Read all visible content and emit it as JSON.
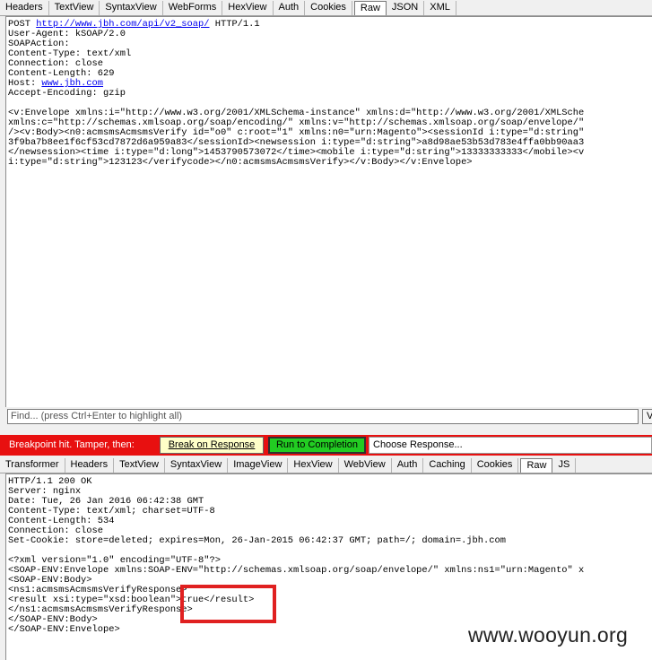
{
  "request_tabs": [
    "Headers",
    "TextView",
    "SyntaxView",
    "WebForms",
    "HexView",
    "Auth",
    "Cookies",
    "Raw",
    "JSON",
    "XML"
  ],
  "request_active_tab": "Raw",
  "request_lines": [
    {
      "pre": "POST ",
      "link": "http://www.jbh.com/api/v2_soap/",
      "post": " HTTP/1.1"
    },
    {
      "pre": "User-Agent: kSOAP/2.0"
    },
    {
      "pre": "SOAPAction:"
    },
    {
      "pre": "Content-Type: text/xml"
    },
    {
      "pre": "Connection: close"
    },
    {
      "pre": "Content-Length: 629"
    },
    {
      "pre": "Host: ",
      "link": "www.jbh.com"
    },
    {
      "pre": "Accept-Encoding: gzip"
    },
    {
      "pre": ""
    },
    {
      "pre": "<v:Envelope xmlns:i=\"http://www.w3.org/2001/XMLSchema-instance\" xmlns:d=\"http://www.w3.org/2001/XMLSche"
    },
    {
      "pre": "xmlns:c=\"http://schemas.xmlsoap.org/soap/encoding/\" xmlns:v=\"http://schemas.xmlsoap.org/soap/envelope/\""
    },
    {
      "pre": "/><v:Body><n0:acmsmsAcmsmsVerify id=\"o0\" c:root=\"1\" xmlns:n0=\"urn:Magento\"><sessionId i:type=\"d:string\""
    },
    {
      "pre": "3f9ba7b8ee1f6cf53cd7872d6a959a83</sessionId><newsession i:type=\"d:string\">a8d98ae53b53d783e4ffa0bb90aa3"
    },
    {
      "pre": "</newsession><time i:type=\"d:long\">1453790573072</time><mobile i:type=\"d:string\">13333333333</mobile><v"
    },
    {
      "pre": "i:type=\"d:string\">123123</verifycode></n0:acmsmsAcmsmsVerify></v:Body></v:Envelope>"
    }
  ],
  "find": {
    "placeholder": "Find... (press Ctrl+Enter to highlight all)",
    "button": "V"
  },
  "breakpoint": {
    "label": "Breakpoint hit. Tamper, then:",
    "break_on_response": "Break on Response",
    "run_to_completion": "Run to Completion",
    "choose_response": "Choose Response..."
  },
  "response_tabs": [
    "Transformer",
    "Headers",
    "TextView",
    "SyntaxView",
    "ImageView",
    "HexView",
    "WebView",
    "Auth",
    "Caching",
    "Cookies",
    "Raw",
    "JS"
  ],
  "response_active_tab": "Raw",
  "response_lines": [
    "HTTP/1.1 200 OK",
    "Server: nginx",
    "Date: Tue, 26 Jan 2016 06:42:38 GMT",
    "Content-Type: text/xml; charset=UTF-8",
    "Content-Length: 534",
    "Connection: close",
    "Set-Cookie: store=deleted; expires=Mon, 26-Jan-2015 06:42:37 GMT; path=/; domain=.jbh.com",
    "",
    "<?xml version=\"1.0\" encoding=\"UTF-8\"?>",
    "<SOAP-ENV:Envelope xmlns:SOAP-ENV=\"http://schemas.xmlsoap.org/soap/envelope/\" xmlns:ns1=\"urn:Magento\" x",
    "<SOAP-ENV:Body>",
    "<ns1:acmsmsAcmsmsVerifyResponse>",
    "<result xsi:type=\"xsd:boolean\">true</result>",
    "</ns1:acmsmsAcmsmsVerifyResponse>",
    "</SOAP-ENV:Body>",
    "</SOAP-ENV:Envelope>"
  ],
  "watermark": "www.wooyun.org",
  "colors": {
    "breakpoint_bar": "#e81010",
    "run_button": "#22cc22",
    "highlight_box": "#e02020"
  }
}
